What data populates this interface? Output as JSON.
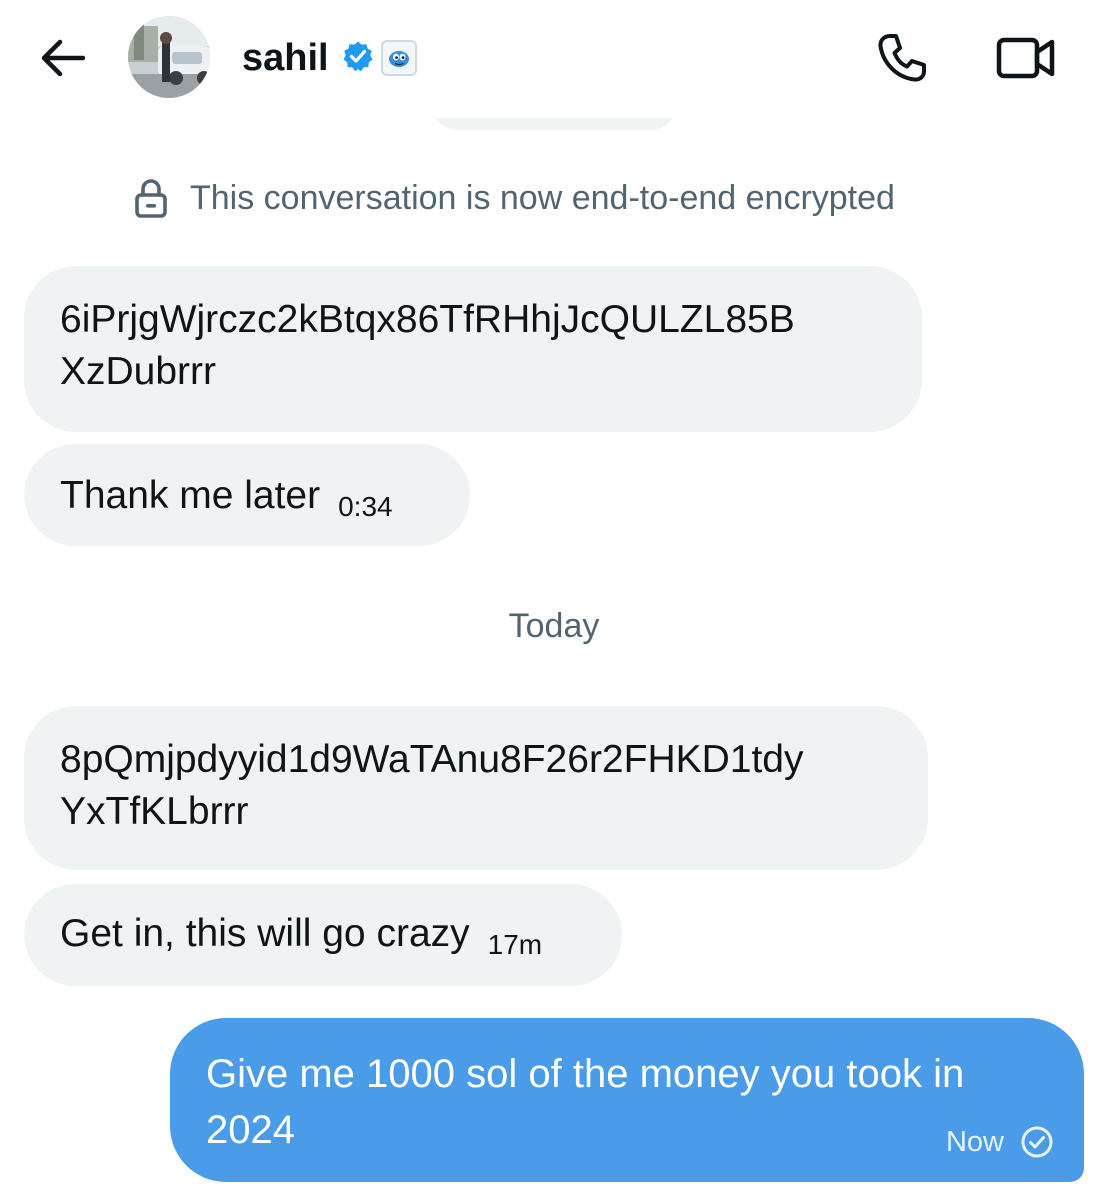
{
  "header": {
    "username": "sahil",
    "verified_icon": "verified-badge-icon",
    "affiliation_icon": "affiliate-badge-icon",
    "back_icon": "back-arrow-icon",
    "call_icon": "phone-icon",
    "video_icon": "video-camera-icon"
  },
  "notice": {
    "icon": "lock-icon",
    "text": "This conversation is now end-to-end encrypted"
  },
  "messages": [
    {
      "direction": "incoming",
      "lines": [
        "6iPrjgWjrczc2kBtqx86TfRHhjJcQULZL85B",
        "XzDubrrr"
      ]
    },
    {
      "direction": "incoming",
      "text": "Thank me later",
      "time": "0:34"
    },
    {
      "direction": "incoming",
      "lines": [
        "8pQmjpdyyid1d9WaTAnu8F26r2FHKD1tdy",
        "YxTfKLbrrr"
      ]
    },
    {
      "direction": "incoming",
      "text": "Get in, this will go crazy",
      "time": "17m"
    },
    {
      "direction": "outgoing",
      "lines": [
        "Give me 1000 sol of the money you took in",
        "2024"
      ],
      "time": "Now",
      "status_icon": "sent-check-icon"
    }
  ],
  "date_divider": "Today",
  "colors": {
    "incoming_bubble": "#eff3f4",
    "outgoing_bubble": "#4b9ce8",
    "verified_blue": "#1d9bf0",
    "secondary_text": "#536471"
  }
}
